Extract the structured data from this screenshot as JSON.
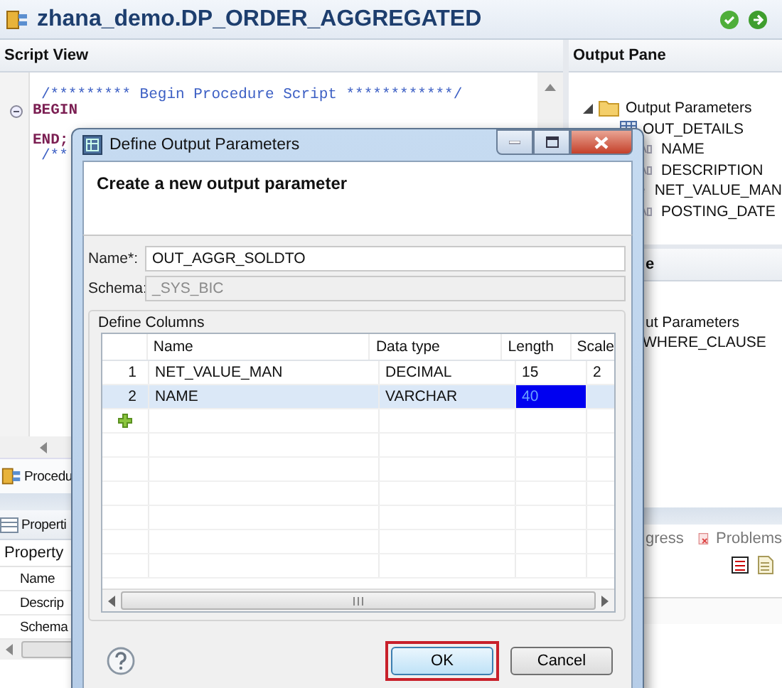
{
  "editor": {
    "title": "zhana_demo.DP_ORDER_AGGREGATED"
  },
  "script_view": {
    "title": "Script View",
    "lines": [
      {
        "kind": "comment",
        "text": "/********* Begin Procedure Script ************/",
        "foldable": false
      },
      {
        "kind": "keyword",
        "text": "BEGIN",
        "foldable": true
      },
      {
        "kind": "blank",
        "foldable": false
      },
      {
        "kind": "keyword",
        "text": "END;",
        "foldable": false
      },
      {
        "kind": "comment",
        "text": "/**",
        "foldable": false
      }
    ]
  },
  "output_pane": {
    "title": "Output Pane",
    "tree": [
      {
        "label": "Output Parameters",
        "expanded": true,
        "children": [
          {
            "label": "OUT_DETAILS",
            "kind": "table",
            "children": [
              {
                "label": "NAME",
                "kind": "text"
              },
              {
                "label": "DESCRIPTION",
                "kind": "text"
              },
              {
                "label": "NET_VALUE_MAN",
                "kind": "number"
              },
              {
                "label": "POSTING_DATE",
                "kind": "text"
              }
            ]
          }
        ]
      }
    ]
  },
  "second_pane": {
    "title": "e",
    "section": "ut Parameters",
    "items": [
      "WHERE_CLAUSE"
    ]
  },
  "procedure_tab": {
    "label": "Procedu"
  },
  "properties": {
    "title": "Properti",
    "column": "Property",
    "rows": [
      "Name",
      "Descrip",
      "Schema"
    ]
  },
  "bottom_tabs": [
    "gress",
    "Problems"
  ],
  "dialog": {
    "title": "Define Output Parameters",
    "heading": "Create a new output parameter",
    "fields": [
      {
        "label": "Name*:",
        "value": "OUT_AGGR_SOLDTO",
        "disabled": false
      },
      {
        "label": "Schema:",
        "value": "_SYS_BIC",
        "disabled": true
      }
    ],
    "group": "Define Columns",
    "table": {
      "columns": [
        "Name",
        "Data type",
        "Length",
        "Scale"
      ],
      "rows": [
        {
          "number": "1",
          "name": "NET_VALUE_MAN",
          "data_type": "DECIMAL",
          "length": "15",
          "scale": "2",
          "selected": false,
          "length_editing": false
        },
        {
          "number": "2",
          "name": "NAME",
          "data_type": "VARCHAR",
          "length": "40",
          "selected": true,
          "length_editing": true
        }
      ]
    },
    "buttons": [
      {
        "label": "OK",
        "default": true
      },
      {
        "label": "Cancel",
        "default": false
      }
    ]
  }
}
